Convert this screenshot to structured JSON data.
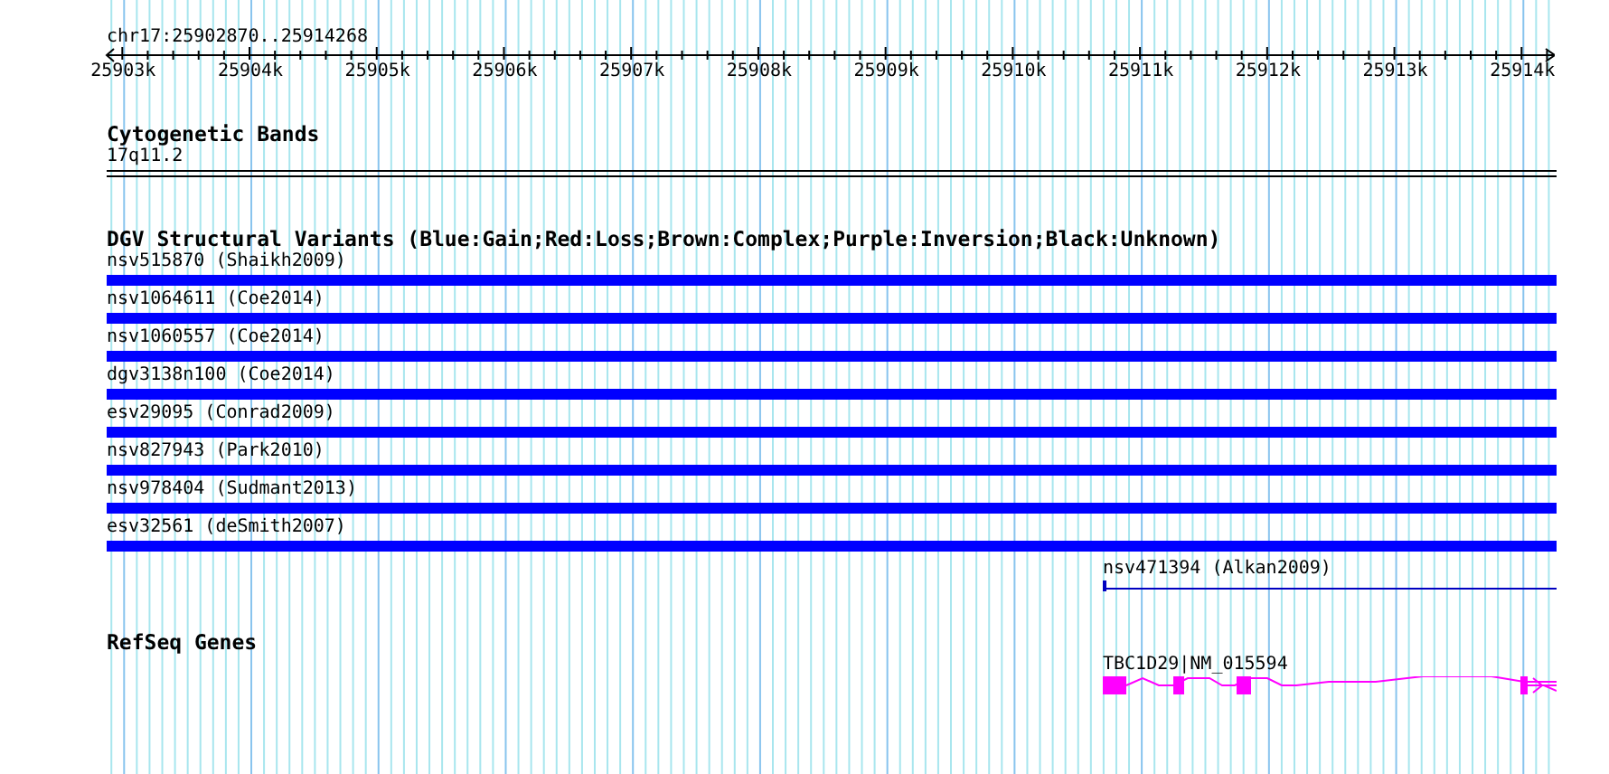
{
  "ruler": {
    "label": "chr17:25902870..25914268",
    "ticks": [
      "25903k",
      "25904k",
      "25905k",
      "25906k",
      "25907k",
      "25908k",
      "25909k",
      "25910k",
      "25911k",
      "25912k",
      "25913k",
      "25914k"
    ]
  },
  "cytoband": {
    "title": "Cytogenetic Bands",
    "band": "17q11.2"
  },
  "variants": {
    "title": "DGV Structural Variants (Blue:Gain;Red:Loss;Brown:Complex;Purple:Inversion;Black:Unknown)",
    "items": [
      {
        "label": "nsv515870 (Shaikh2009)",
        "kind": "bar",
        "color": "#0000ff"
      },
      {
        "label": "nsv1064611 (Coe2014)",
        "kind": "bar",
        "color": "#0000ff"
      },
      {
        "label": "nsv1060557 (Coe2014)",
        "kind": "bar",
        "color": "#0000ff"
      },
      {
        "label": "dgv3138n100 (Coe2014)",
        "kind": "bar",
        "color": "#0000ff"
      },
      {
        "label": "esv29095 (Conrad2009)",
        "kind": "bar",
        "color": "#0000ff"
      },
      {
        "label": "nsv827943 (Park2010)",
        "kind": "bar",
        "color": "#0000ff"
      },
      {
        "label": "nsv978404 (Sudmant2013)",
        "kind": "bar",
        "color": "#0000ff"
      },
      {
        "label": "esv32561 (deSmith2007)",
        "kind": "bar",
        "color": "#0000ff"
      },
      {
        "label": "nsv471394 (Alkan2009)",
        "kind": "line",
        "color": "#0000c0"
      }
    ]
  },
  "genes": {
    "title": "RefSeq Genes",
    "items": [
      {
        "label": "TBC1D29|NM_015594"
      }
    ]
  }
}
